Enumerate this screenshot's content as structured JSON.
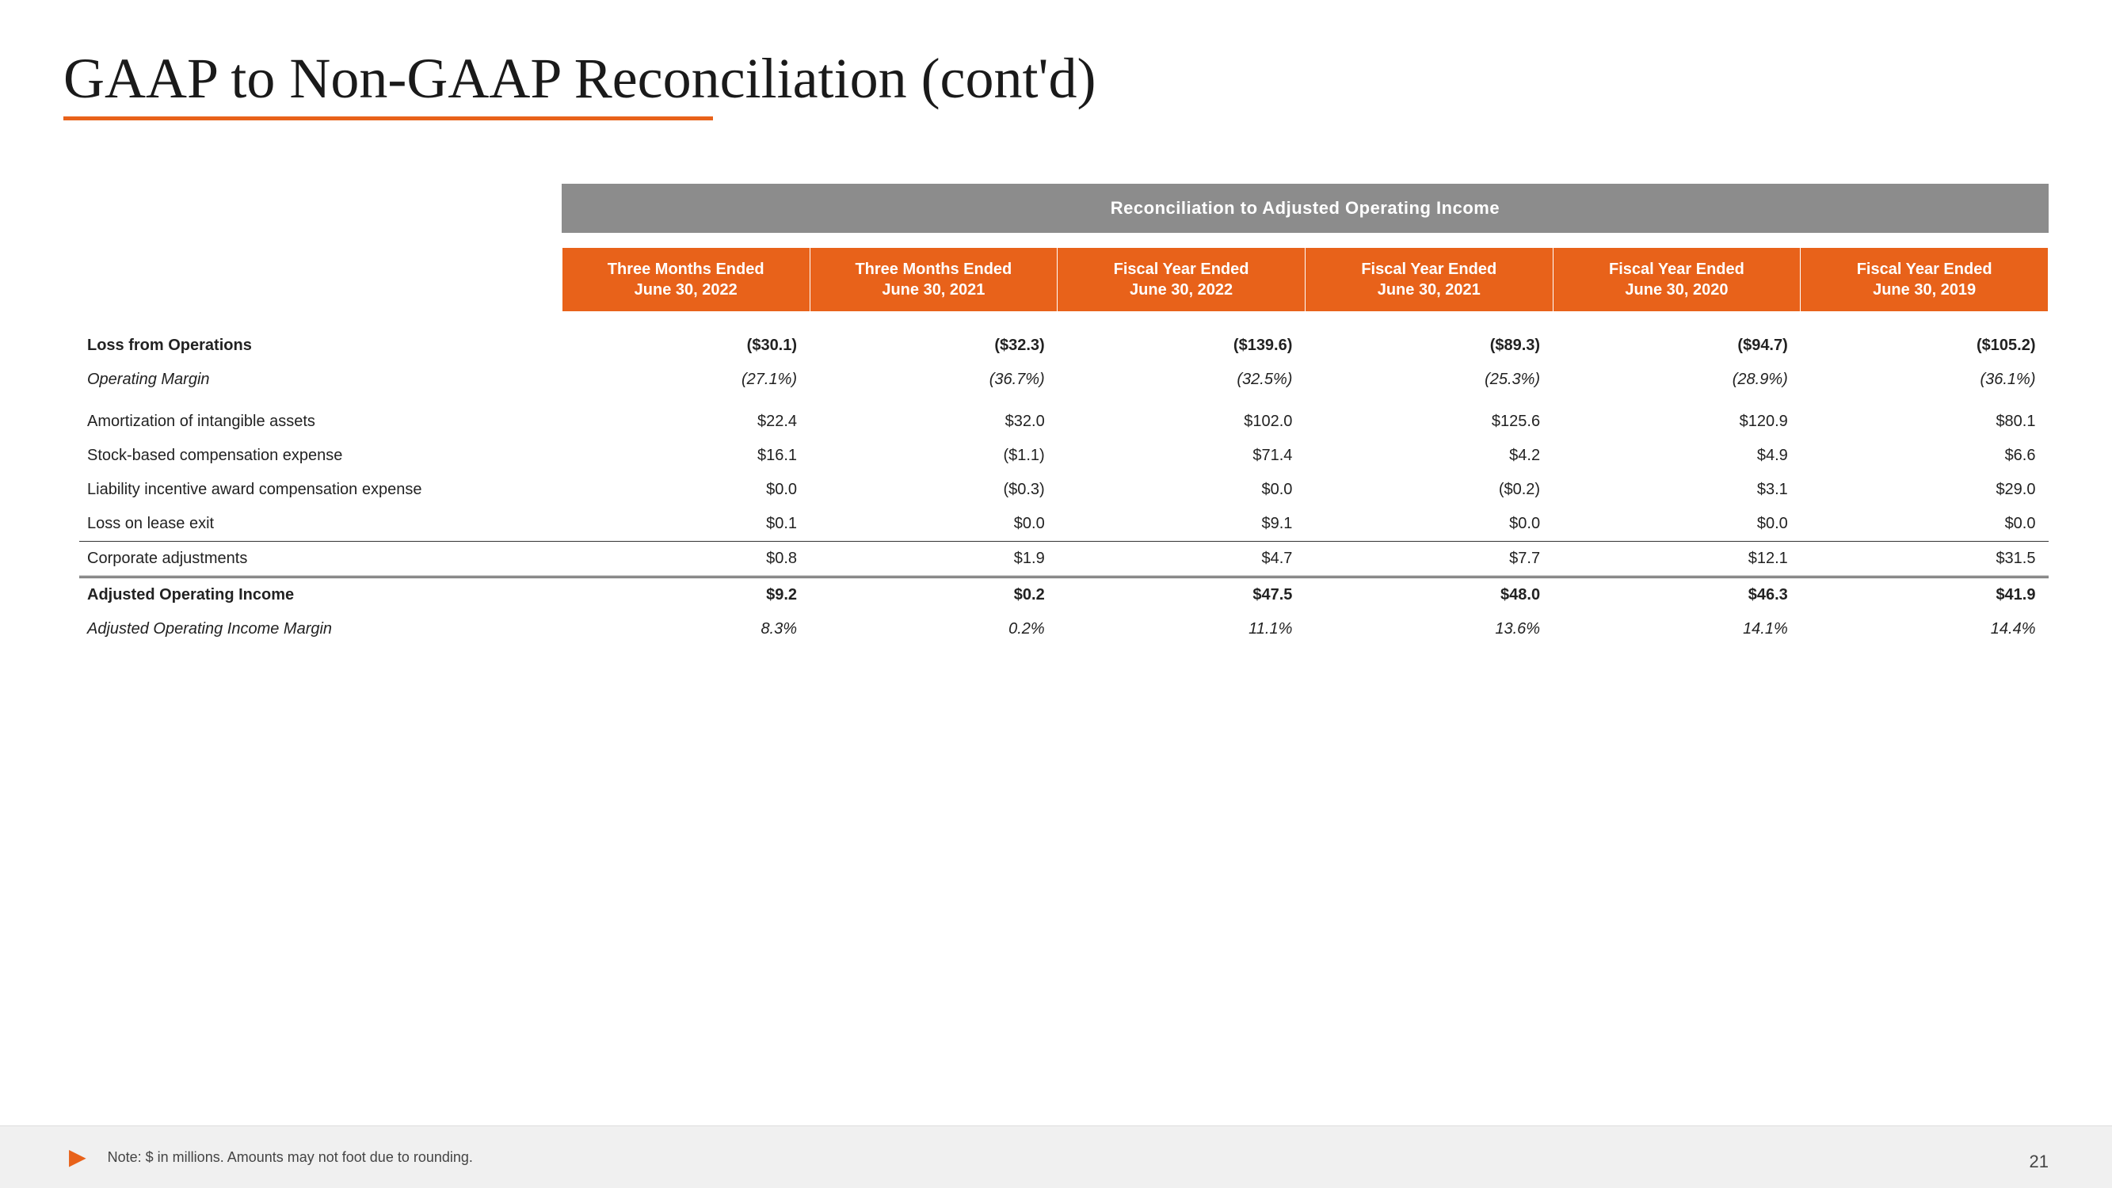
{
  "title": "GAAP to Non-GAAP Reconciliation (cont'd)",
  "underline_color": "#e8621a",
  "table": {
    "banner": "Reconciliation to Adjusted Operating Income",
    "columns": [
      {
        "line1": "Three Months Ended",
        "line2": "June 30, 2022"
      },
      {
        "line1": "Three Months Ended",
        "line2": "June 30, 2021"
      },
      {
        "line1": "Fiscal Year Ended",
        "line2": "June 30, 2022"
      },
      {
        "line1": "Fiscal Year Ended",
        "line2": "June 30, 2021"
      },
      {
        "line1": "Fiscal Year Ended",
        "line2": "June 30, 2020"
      },
      {
        "line1": "Fiscal Year Ended",
        "line2": "June 30, 2019"
      }
    ],
    "rows": [
      {
        "type": "bold",
        "label": "Loss from Operations",
        "values": [
          "($30.1)",
          "($32.3)",
          "($139.6)",
          "($89.3)",
          "($94.7)",
          "($105.2)"
        ]
      },
      {
        "type": "italic",
        "label": "Operating Margin",
        "values": [
          "(27.1%)",
          "(36.7%)",
          "(32.5%)",
          "(25.3%)",
          "(28.9%)",
          "(36.1%)"
        ]
      },
      {
        "type": "normal",
        "label": "Amortization of intangible assets",
        "values": [
          "$22.4",
          "$32.0",
          "$102.0",
          "$125.6",
          "$120.9",
          "$80.1"
        ]
      },
      {
        "type": "normal",
        "label": "Stock-based compensation expense",
        "values": [
          "$16.1",
          "($1.1)",
          "$71.4",
          "$4.2",
          "$4.9",
          "$6.6"
        ]
      },
      {
        "type": "normal",
        "label": "Liability incentive award compensation expense",
        "values": [
          "$0.0",
          "($0.3)",
          "$0.0",
          "($0.2)",
          "$3.1",
          "$29.0"
        ]
      },
      {
        "type": "normal",
        "label": "Loss on lease exit",
        "values": [
          "$0.1",
          "$0.0",
          "$9.1",
          "$0.0",
          "$0.0",
          "$0.0"
        ]
      },
      {
        "type": "underline",
        "label": "Corporate adjustments",
        "values": [
          "$0.8",
          "$1.9",
          "$4.7",
          "$7.7",
          "$12.1",
          "$31.5"
        ]
      },
      {
        "type": "bold-double",
        "label": "Adjusted Operating Income",
        "values": [
          "$9.2",
          "$0.2",
          "$47.5",
          "$48.0",
          "$46.3",
          "$41.9"
        ]
      },
      {
        "type": "italic",
        "label": "Adjusted Operating Income Margin",
        "values": [
          "8.3%",
          "0.2%",
          "11.1%",
          "13.6%",
          "14.1%",
          "14.4%"
        ]
      }
    ]
  },
  "footer": {
    "note": "Note: $ in millions. Amounts may not foot due to rounding.",
    "page": "21"
  }
}
